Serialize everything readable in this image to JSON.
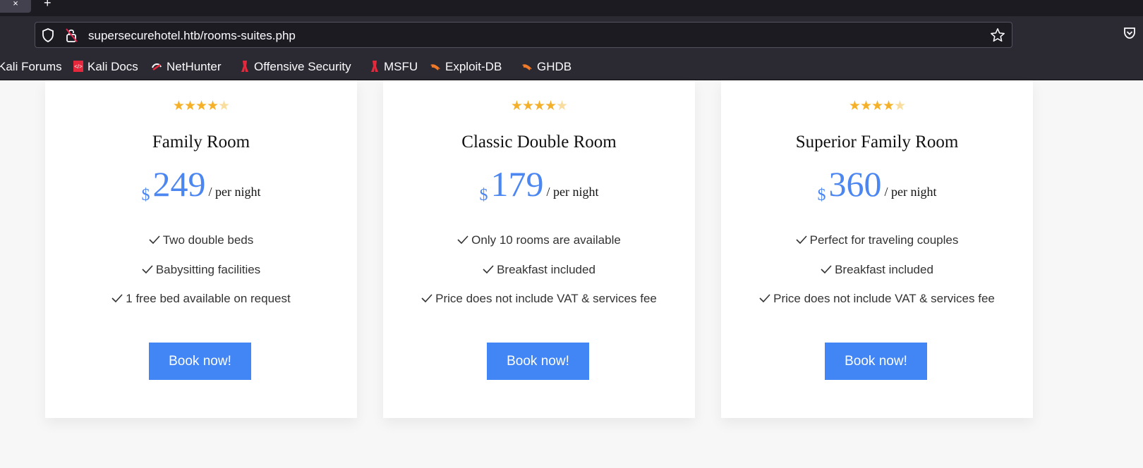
{
  "browser": {
    "tab_close": "×",
    "new_tab": "+",
    "url": "supersecurehotel.htb/rooms-suites.php",
    "bookmarks": [
      "Kali Forums",
      "Kali Docs",
      "NetHunter",
      "Offensive Security",
      "MSFU",
      "Exploit-DB",
      "GHDB"
    ]
  },
  "rooms": [
    {
      "rating": 4,
      "max_rating": 5,
      "name": "Family Room",
      "currency": "$",
      "price": "249",
      "per": "/ per night",
      "features": [
        "Two double beds",
        "Babysitting facilities",
        "1 free bed available on request"
      ],
      "button": "Book now!"
    },
    {
      "rating": 4,
      "max_rating": 5,
      "name": "Classic Double Room",
      "currency": "$",
      "price": "179",
      "per": "/ per night",
      "features": [
        "Only 10 rooms are available",
        "Breakfast included",
        "Price does not include VAT & services fee"
      ],
      "button": "Book now!"
    },
    {
      "rating": 4,
      "max_rating": 5,
      "name": "Superior Family Room",
      "currency": "$",
      "price": "360",
      "per": "/ per night",
      "features": [
        "Perfect for traveling couples",
        "Breakfast included",
        "Price does not include VAT & services fee"
      ],
      "button": "Book now!"
    }
  ],
  "colors": {
    "accent": "#4285f4",
    "price": "#4c87f1",
    "star": "#f5b02a",
    "star_empty": "#f8dd9f"
  }
}
